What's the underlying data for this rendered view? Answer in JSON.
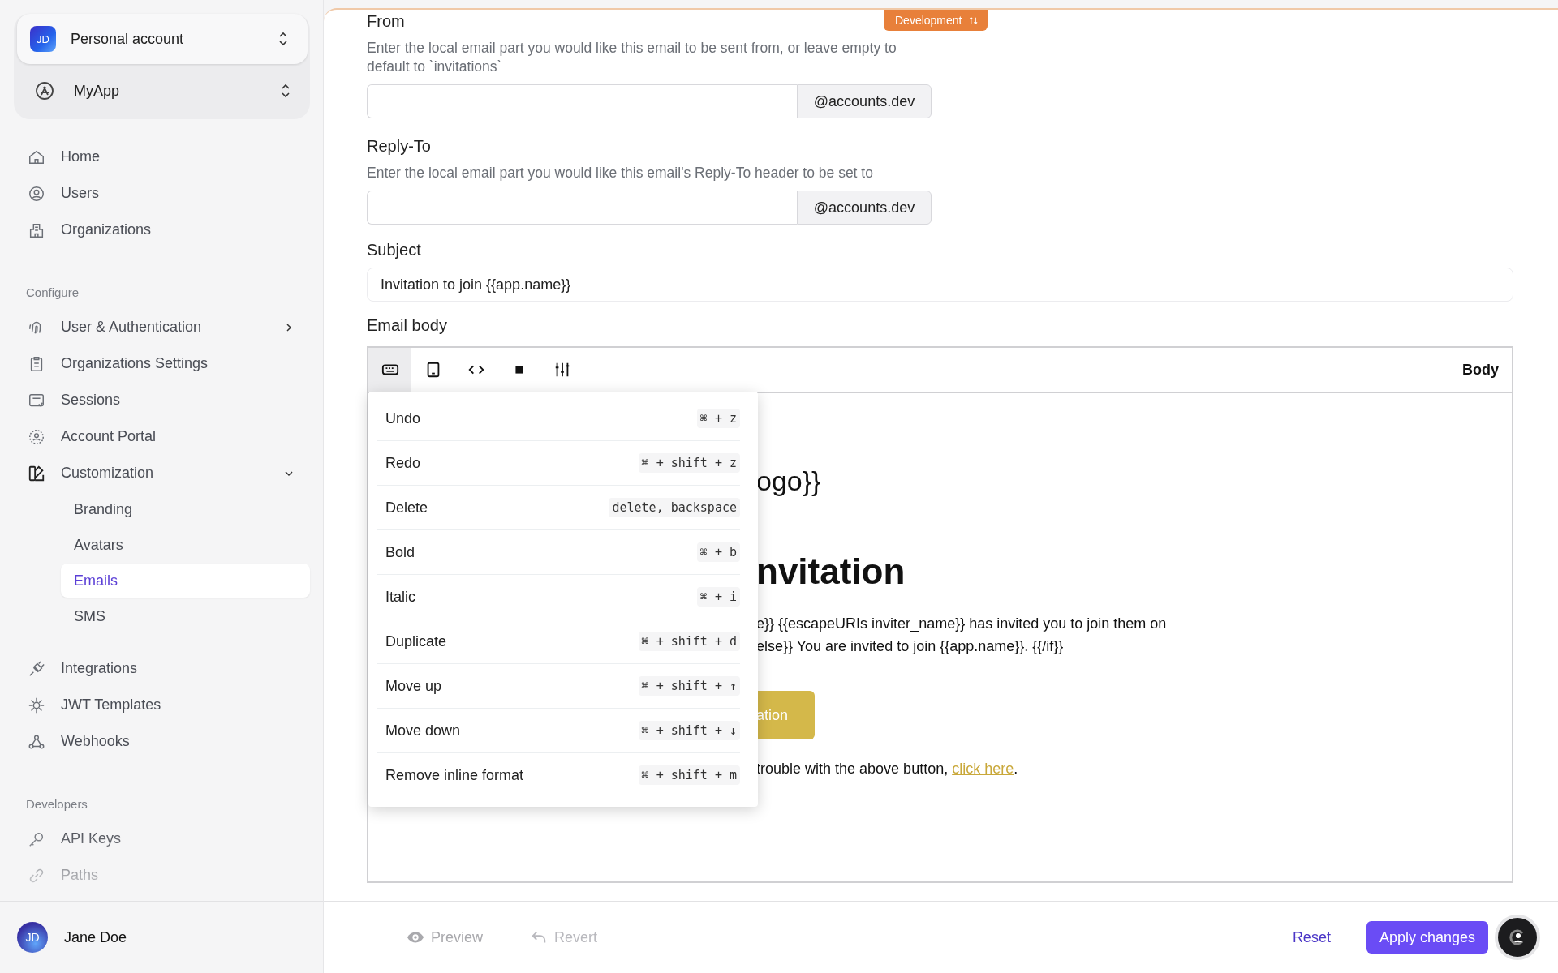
{
  "sidebar": {
    "account": {
      "initials": "JD",
      "name": "Personal account"
    },
    "app": {
      "name": "MyApp"
    },
    "sections": [
      {
        "items": [
          {
            "label": "Home",
            "selected": false
          },
          {
            "label": "Users",
            "selected": false
          },
          {
            "label": "Organizations",
            "selected": false
          }
        ]
      },
      {
        "title": "Configure",
        "items": [
          {
            "label": "User & Authentication",
            "selected": false,
            "expanded": false
          },
          {
            "label": "Organizations Settings",
            "selected": false
          },
          {
            "label": "Sessions",
            "selected": false
          },
          {
            "label": "Account Portal",
            "selected": false
          },
          {
            "label": "Customization",
            "selected": false,
            "expanded": true,
            "children": [
              {
                "label": "Branding",
                "selected": false
              },
              {
                "label": "Avatars",
                "selected": false
              },
              {
                "label": "Emails",
                "selected": true
              },
              {
                "label": "SMS",
                "selected": false
              }
            ]
          }
        ]
      },
      {
        "items": [
          {
            "label": "Integrations",
            "selected": false
          },
          {
            "label": "JWT Templates",
            "selected": false
          },
          {
            "label": "Webhooks",
            "selected": false
          }
        ]
      },
      {
        "title": "Developers",
        "items": [
          {
            "label": "API Keys",
            "selected": false
          },
          {
            "label": "Paths",
            "selected": false
          }
        ]
      }
    ],
    "user": {
      "initials": "JD",
      "name": "Jane Doe"
    }
  },
  "env_badge": "Development",
  "form": {
    "from": {
      "label": "From",
      "description": "Enter the local email part you would like this email to be sent from, or leave empty to default to `invitations`",
      "suffix": "@accounts.dev"
    },
    "reply_to": {
      "label": "Reply-To",
      "description": "Enter the local email part you would like this email's Reply-To header to be set to",
      "suffix": "@accounts.dev"
    },
    "subject": {
      "label": "Subject",
      "value": "Invitation to join {{app.name}}"
    },
    "body_label": "Email body"
  },
  "editor": {
    "tools": [
      {
        "selected": true
      },
      {
        "selected": false
      },
      {
        "selected": false
      },
      {
        "selected": false
      },
      {
        "selected": false
      }
    ],
    "mode_label": "Body",
    "menu": [
      {
        "label": "Undo",
        "shortcut": "⌘ + z"
      },
      {
        "label": "Redo",
        "shortcut": "⌘ + shift + z"
      },
      {
        "label": "Delete",
        "shortcut": "delete, backspace"
      },
      {
        "label": "Bold",
        "shortcut": "⌘ + b"
      },
      {
        "label": "Italic",
        "shortcut": "⌘ + i"
      },
      {
        "label": "Duplicate",
        "shortcut": "⌘ + shift + d"
      },
      {
        "label": "Move up",
        "shortcut": "⌘ + shift + ↑"
      },
      {
        "label": "Move down",
        "shortcut": "⌘ + shift + ↓"
      },
      {
        "label": "Remove inline format",
        "shortcut": "⌘ + shift + m"
      }
    ],
    "preview": {
      "logo": "ogo}}",
      "heading": "nvitation",
      "paragraph": [
        "e}} {{escapeURIs inviter_name}} has invited you to join them on",
        "else}} You are invited to join {{app.name}}. {{/if}}"
      ],
      "button": "ation",
      "footer": "trouble with the above button, ",
      "link": "click here",
      "footer_end": "."
    }
  },
  "footer": {
    "preview": {
      "label": "Preview",
      "disabled": true
    },
    "revert": {
      "label": "Revert",
      "disabled": true
    },
    "reset": "Reset",
    "apply": "Apply changes"
  }
}
